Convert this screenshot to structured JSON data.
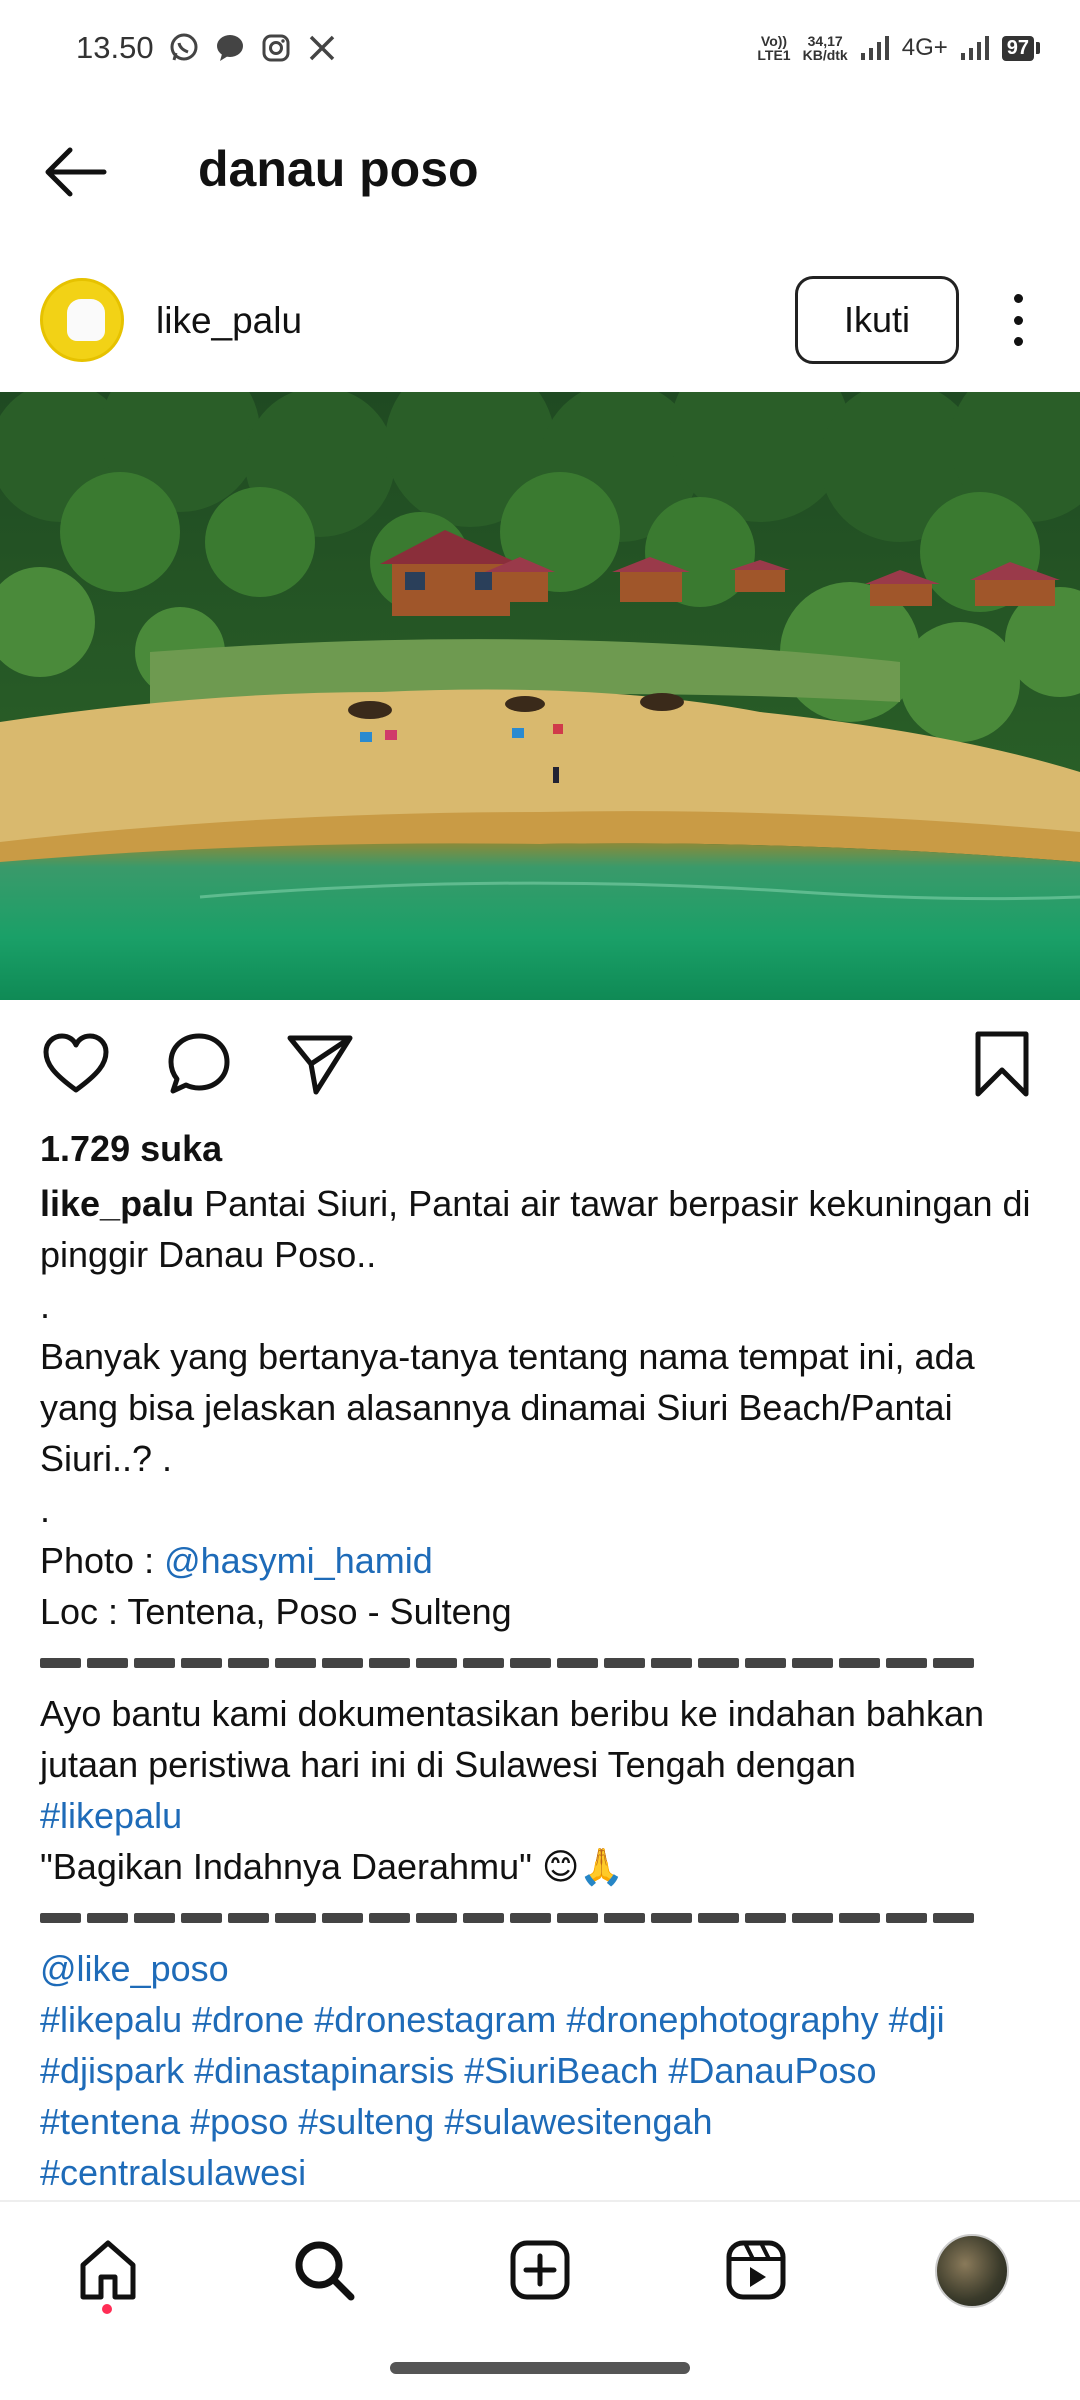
{
  "status_bar": {
    "time": "13.50",
    "app_icons": [
      "whatsapp-icon",
      "message-icon",
      "instagram-icon",
      "x-icon"
    ],
    "volte": "Vo))",
    "lte": "LTE1",
    "speed_value": "34,17",
    "speed_unit": "KB/dtk",
    "network": "4G+",
    "battery": "97"
  },
  "header": {
    "title": "danau poso"
  },
  "post": {
    "username": "like_palu",
    "follow_label": "Ikuti",
    "likes": "1.729 suka",
    "caption": {
      "user": "like_palu",
      "line1": " Pantai Siuri, Pantai air tawar berpasir kekuningan di pinggir Danau Poso..",
      "dot1": ".",
      "line2": "Banyak yang bertanya-tanya tentang nama tempat ini, ada yang bisa jelaskan alasannya dinamai Siuri Beach/Pantai Siuri..? .",
      "dot2": ".",
      "photo_label": "Photo : ",
      "photo_credit": "@hasymi_hamid",
      "loc": "Loc : Tentena, Poso - Sulteng",
      "line3": "Ayo bantu kami dokumentasikan beribu ke indahan bahkan jutaan peristiwa hari ini di Sulawesi Tengah dengan",
      "hashtag_main": "#likepalu",
      "tagline": "\"Bagikan Indahnya Daerahmu\" 😊🙏",
      "mention": "@like_poso",
      "hashtags1": "#likepalu #drone #dronestagram #dronephotography #dji",
      "hashtags2": "#djispark #dinastapinarsis #SiuriBeach #DanauPoso",
      "hashtags3": "#tentena #poso #sulteng #sulawesitengah",
      "hashtags4": "#centralsulawesi"
    }
  },
  "bottom_nav": {
    "items": [
      "home-icon",
      "search-icon",
      "create-icon",
      "reels-icon",
      "profile-avatar"
    ]
  },
  "colors": {
    "link": "#1e6bb8",
    "notification_dot": "#ff2d55"
  }
}
